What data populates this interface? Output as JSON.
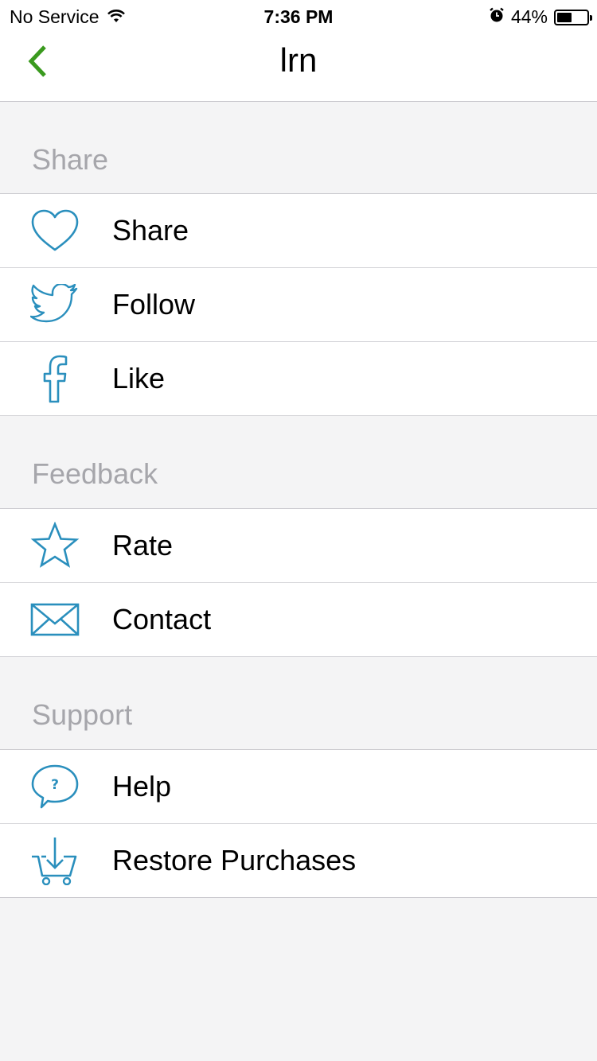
{
  "status_bar": {
    "carrier": "No Service",
    "time": "7:36 PM",
    "battery_percent": "44%",
    "battery_level": 0.44,
    "wifi_icon": "wifi-icon",
    "alarm_icon": "alarm-clock-icon"
  },
  "nav": {
    "title": "lrn",
    "back_icon": "chevron-left-icon"
  },
  "colors": {
    "accent_green": "#3a9a1e",
    "icon_blue": "#2a8fbd",
    "section_text": "#a6a6ab",
    "background": "#f4f4f5"
  },
  "sections": [
    {
      "header": "Share",
      "items": [
        {
          "label": "Share",
          "icon": "heart-icon"
        },
        {
          "label": "Follow",
          "icon": "twitter-bird-icon"
        },
        {
          "label": "Like",
          "icon": "facebook-icon"
        }
      ]
    },
    {
      "header": "Feedback",
      "items": [
        {
          "label": "Rate",
          "icon": "star-icon"
        },
        {
          "label": "Contact",
          "icon": "envelope-icon"
        }
      ]
    },
    {
      "header": "Support",
      "items": [
        {
          "label": "Help",
          "icon": "help-bubble-icon"
        },
        {
          "label": "Restore Purchases",
          "icon": "cart-download-icon"
        }
      ]
    }
  ]
}
